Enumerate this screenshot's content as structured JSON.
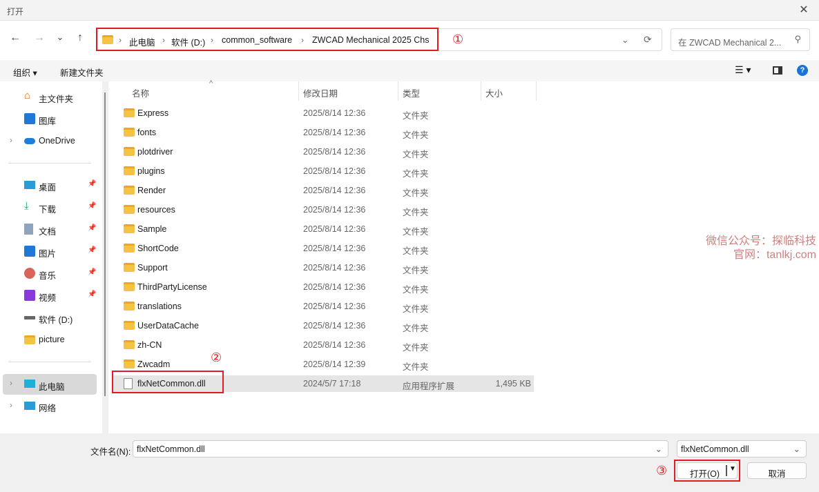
{
  "window": {
    "title": "打开"
  },
  "nav": {
    "back": "←",
    "forward": "→",
    "recent": "⌄",
    "up": "↑",
    "breadcrumb": [
      "此电脑",
      "软件 (D:)",
      "common_software",
      "ZWCAD Mechanical 2025 Chs"
    ],
    "search_placeholder": "在 ZWCAD Mechanical 2...",
    "refresh": "⟳"
  },
  "annotations": {
    "one": "①",
    "two": "②",
    "three": "③"
  },
  "toolbar": {
    "organize": "组织 ▾",
    "new_folder": "新建文件夹"
  },
  "sidebar": {
    "items": [
      {
        "label": "主文件夹"
      },
      {
        "label": "图库"
      },
      {
        "label": "OneDrive"
      },
      {
        "label": "桌面"
      },
      {
        "label": "下载"
      },
      {
        "label": "文档"
      },
      {
        "label": "图片"
      },
      {
        "label": "音乐"
      },
      {
        "label": "视频"
      },
      {
        "label": "软件 (D:)"
      },
      {
        "label": "picture"
      },
      {
        "label": "此电脑"
      },
      {
        "label": "网络"
      }
    ]
  },
  "columns": {
    "name": "名称",
    "date": "修改日期",
    "type": "类型",
    "size": "大小"
  },
  "files": [
    {
      "name": "Express",
      "date": "2025/8/14 12:36",
      "type": "文件夹",
      "size": ""
    },
    {
      "name": "fonts",
      "date": "2025/8/14 12:36",
      "type": "文件夹",
      "size": ""
    },
    {
      "name": "plotdriver",
      "date": "2025/8/14 12:36",
      "type": "文件夹",
      "size": ""
    },
    {
      "name": "plugins",
      "date": "2025/8/14 12:36",
      "type": "文件夹",
      "size": ""
    },
    {
      "name": "Render",
      "date": "2025/8/14 12:36",
      "type": "文件夹",
      "size": ""
    },
    {
      "name": "resources",
      "date": "2025/8/14 12:36",
      "type": "文件夹",
      "size": ""
    },
    {
      "name": "Sample",
      "date": "2025/8/14 12:36",
      "type": "文件夹",
      "size": ""
    },
    {
      "name": "ShortCode",
      "date": "2025/8/14 12:36",
      "type": "文件夹",
      "size": ""
    },
    {
      "name": "Support",
      "date": "2025/8/14 12:36",
      "type": "文件夹",
      "size": ""
    },
    {
      "name": "ThirdPartyLicense",
      "date": "2025/8/14 12:36",
      "type": "文件夹",
      "size": ""
    },
    {
      "name": "translations",
      "date": "2025/8/14 12:36",
      "type": "文件夹",
      "size": ""
    },
    {
      "name": "UserDataCache",
      "date": "2025/8/14 12:36",
      "type": "文件夹",
      "size": ""
    },
    {
      "name": "zh-CN",
      "date": "2025/8/14 12:36",
      "type": "文件夹",
      "size": ""
    },
    {
      "name": "Zwcadm",
      "date": "2025/8/14 12:39",
      "type": "文件夹",
      "size": ""
    },
    {
      "name": "flxNetCommon.dll",
      "date": "2024/5/7 17:18",
      "type": "应用程序扩展",
      "size": "1,495 KB"
    }
  ],
  "bottom": {
    "filename_label": "文件名(N):",
    "filename_value": "flxNetCommon.dll",
    "filter_value": "flxNetCommon.dll",
    "open": "打开(O)",
    "cancel": "取消"
  },
  "watermark": {
    "line1": "微信公众号：探临科技",
    "line2": "官网：tanlkj.com"
  }
}
